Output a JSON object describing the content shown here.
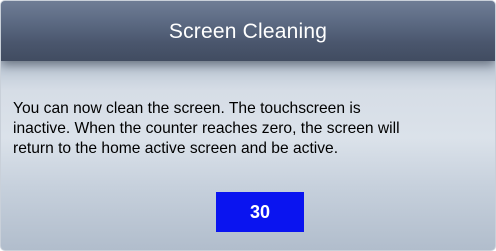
{
  "title": "Screen Cleaning",
  "message_lines": [
    "You can now clean the screen. The touchscreen is",
    "inactive. When the counter reaches zero, the screen will",
    "return to the home active screen and be active."
  ],
  "counter": "30",
  "colors": {
    "title_bar": "#4f5b72",
    "counter_background": "#0a14f0",
    "counter_text": "#ffffff"
  }
}
